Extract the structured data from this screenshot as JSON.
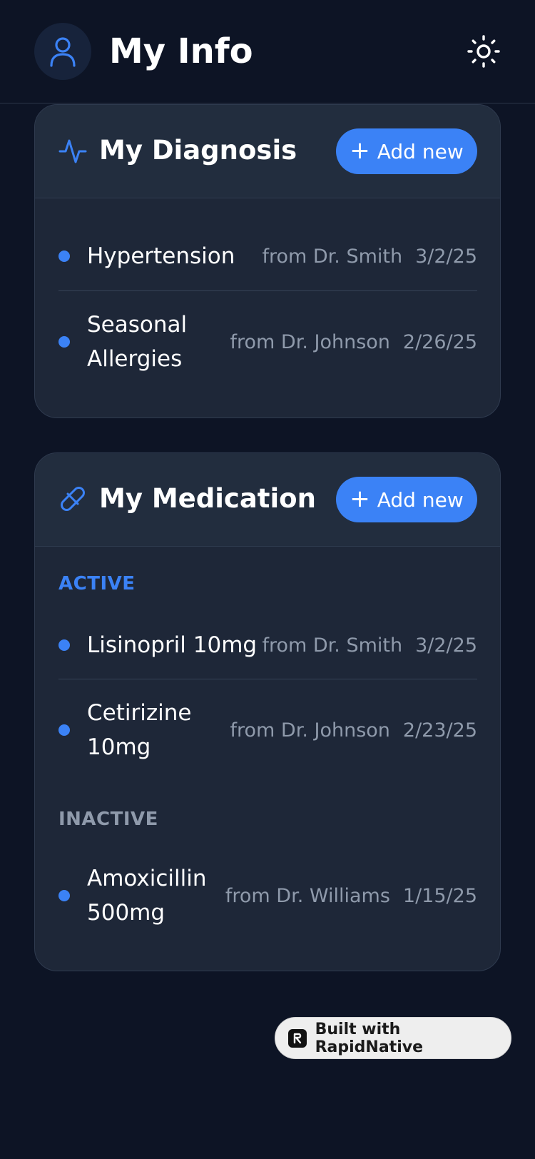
{
  "header": {
    "title": "My Info",
    "avatar_icon": "user-icon",
    "theme_icon": "sun-icon"
  },
  "diagnosis": {
    "title": "My Diagnosis",
    "icon": "activity-icon",
    "add_label": "Add new",
    "items": [
      {
        "name": "Hypertension",
        "doctor": "from Dr. Smith",
        "date": "3/2/25"
      },
      {
        "name": "Seasonal Allergies",
        "doctor": "from Dr. Johnson",
        "date": "2/26/25"
      }
    ]
  },
  "medication": {
    "title": "My Medication",
    "icon": "pill-icon",
    "add_label": "Add new",
    "active_label": "ACTIVE",
    "inactive_label": "INACTIVE",
    "active": [
      {
        "name": "Lisinopril 10mg",
        "doctor": "from Dr. Smith",
        "date": "3/2/25"
      },
      {
        "name": "Cetirizine 10mg",
        "doctor": "from Dr. Johnson",
        "date": "2/23/25"
      }
    ],
    "inactive": [
      {
        "name": "Amoxicillin 500mg",
        "doctor": "from Dr. Williams",
        "date": "1/15/25"
      }
    ]
  },
  "badge": {
    "label": "Built with RapidNative"
  },
  "colors": {
    "background": "#0d1425",
    "card": "#1e2738",
    "accent": "#3b82f6",
    "muted": "#8f9aab"
  }
}
